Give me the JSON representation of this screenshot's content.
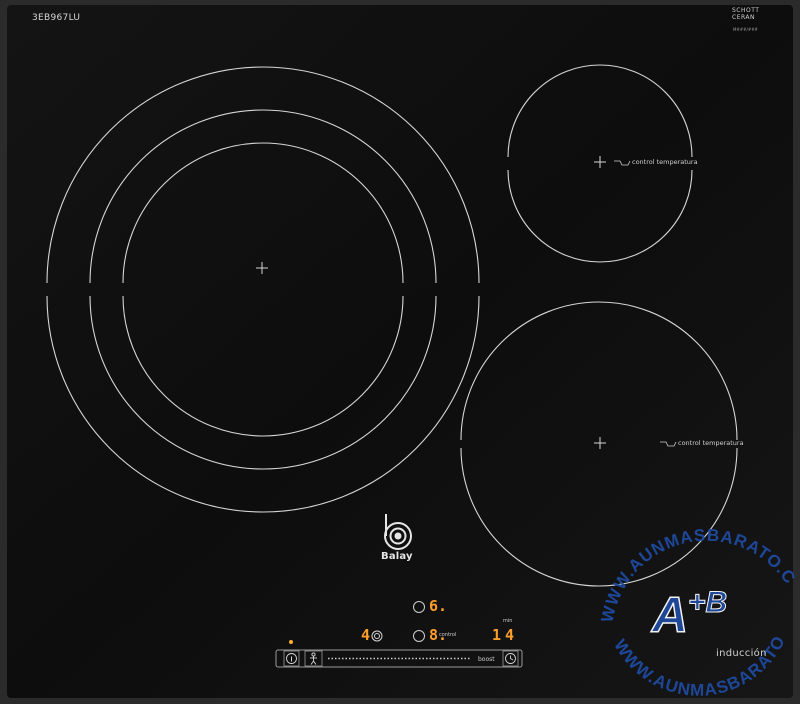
{
  "hob": {
    "model": "3EB967LU",
    "glass_brand": [
      "SCHOTT",
      "CERAN"
    ],
    "glass_code": "M###/###",
    "brand": "Balay",
    "type_label": "inducción",
    "zone_label_top_right": "control temperatura",
    "zone_label_bottom_right": "control temperatura"
  },
  "controls": {
    "display_top": "6.",
    "display_left": "4",
    "display_middle": "8.",
    "display_middle_sub": "control",
    "display_right": "14",
    "display_right_sub": "min",
    "indicator_color": "#ff9d2a",
    "sensor_labels": [
      "boost"
    ]
  },
  "watermark": {
    "text": "WWW.AUNMASBARATO.COM",
    "logo_a": "A",
    "logo_sup": "+B",
    "color": "#1f4aa0"
  },
  "icons": [
    "crosshair-icon",
    "balay-logo-icon",
    "info-icon",
    "child-lock-icon",
    "timer-icon",
    "pot-icon",
    "sensor-circle-icon"
  ]
}
